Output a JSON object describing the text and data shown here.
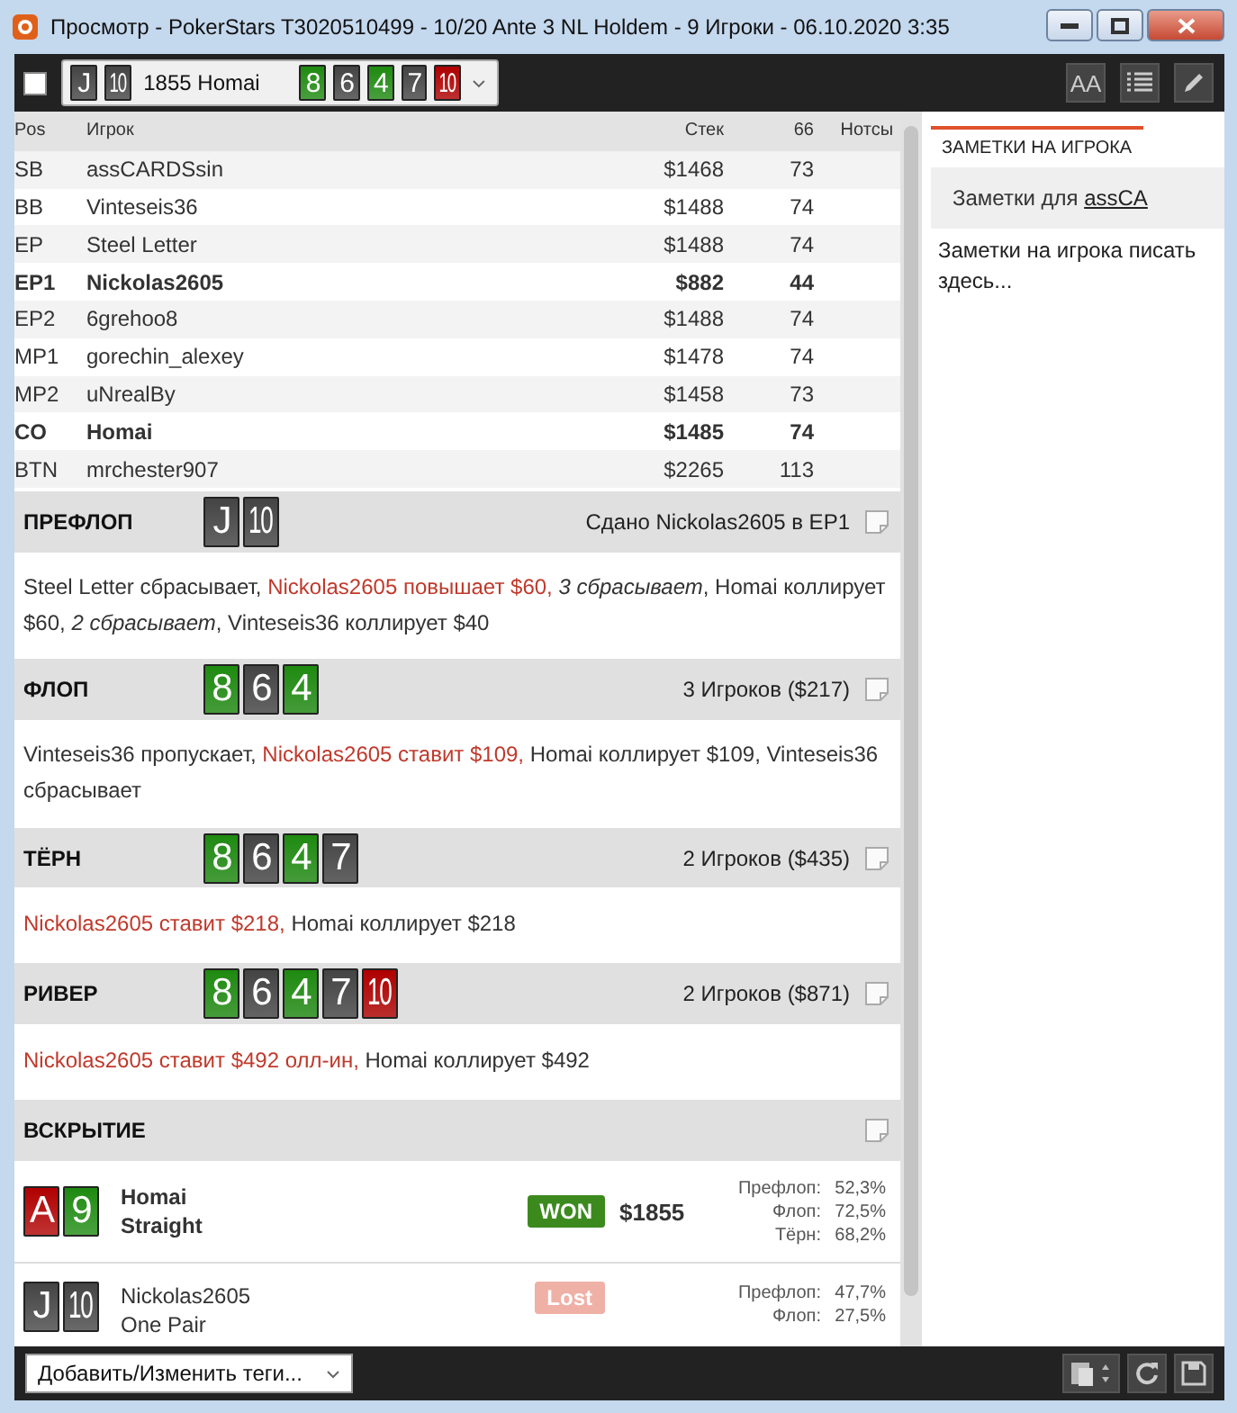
{
  "window": {
    "title": "Просмотр - PokerStars T3020510499 - 10/20 Ante 3 NL Holdem - 9 Игроки - 06.10.2020 3:35"
  },
  "toolbar": {
    "checked": false,
    "hand": {
      "hole_cards": [
        {
          "rank": "J",
          "color": "#444444"
        },
        {
          "rank": "10",
          "color": "#444444"
        }
      ],
      "label": "1855 Homai",
      "board": [
        {
          "rank": "8",
          "color": "#1e8a10"
        },
        {
          "rank": "6",
          "color": "#444444"
        },
        {
          "rank": "4",
          "color": "#1e8a10"
        },
        {
          "rank": "7",
          "color": "#444444"
        },
        {
          "rank": "10",
          "color": "#b00000"
        }
      ]
    },
    "font_button": "AA"
  },
  "table": {
    "columns": [
      "Pos",
      "Игрок",
      "Стек",
      "66",
      "Нотсы"
    ],
    "rows": [
      {
        "pos": "SB",
        "player": "assCARDSsin",
        "stack": "$1468",
        "hands": "73",
        "highlighted": false
      },
      {
        "pos": "BB",
        "player": "Vinteseis36",
        "stack": "$1488",
        "hands": "74",
        "highlighted": false
      },
      {
        "pos": "EP",
        "player": "Steel Letter",
        "stack": "$1488",
        "hands": "74",
        "highlighted": false
      },
      {
        "pos": "EP1",
        "player": "Nickolas2605",
        "stack": "$882",
        "hands": "44",
        "highlighted": true
      },
      {
        "pos": "EP2",
        "player": "6grehoo8",
        "stack": "$1488",
        "hands": "74",
        "highlighted": false
      },
      {
        "pos": "MP1",
        "player": "gorechin_alexey",
        "stack": "$1478",
        "hands": "74",
        "highlighted": false
      },
      {
        "pos": "MP2",
        "player": "uNrealBy",
        "stack": "$1458",
        "hands": "73",
        "highlighted": false
      },
      {
        "pos": "CO",
        "player": "Homai",
        "stack": "$1485",
        "hands": "74",
        "highlighted": true
      },
      {
        "pos": "BTN",
        "player": "mrchester907",
        "stack": "$2265",
        "hands": "113",
        "highlighted": false
      }
    ]
  },
  "streets": [
    {
      "name": "ПРЕФЛОП",
      "cards": [
        {
          "rank": "J",
          "color": "#444444"
        },
        {
          "rank": "10",
          "color": "#444444"
        }
      ],
      "summary": "Сдано Nickolas2605 в EP1",
      "actions": [
        {
          "kind": "plain",
          "text": "Steel Letter сбрасывает, "
        },
        {
          "kind": "hero",
          "text": "Nickolas2605 повышает $60, "
        },
        {
          "kind": "folds",
          "text": "3 сбрасывает"
        },
        {
          "kind": "plain",
          "text": ", Homai коллирует $60, "
        },
        {
          "kind": "folds",
          "text": "2 сбрасывает"
        },
        {
          "kind": "plain",
          "text": ", Vinteseis36 коллирует $40"
        }
      ]
    },
    {
      "name": "ФЛОП",
      "cards": [
        {
          "rank": "8",
          "color": "#1e8a10"
        },
        {
          "rank": "6",
          "color": "#444444"
        },
        {
          "rank": "4",
          "color": "#1e8a10"
        }
      ],
      "summary": "3 Игроков ($217)",
      "actions": [
        {
          "kind": "plain",
          "text": "Vinteseis36 пропускает, "
        },
        {
          "kind": "hero",
          "text": "Nickolas2605 ставит $109, "
        },
        {
          "kind": "plain",
          "text": "Homai коллирует $109, Vinteseis36 сбрасывает"
        }
      ]
    },
    {
      "name": "ТЁРН",
      "cards": [
        {
          "rank": "8",
          "color": "#1e8a10"
        },
        {
          "rank": "6",
          "color": "#444444"
        },
        {
          "rank": "4",
          "color": "#1e8a10"
        },
        {
          "rank": "7",
          "color": "#444444"
        }
      ],
      "summary": "2 Игроков ($435)",
      "actions": [
        {
          "kind": "hero",
          "text": "Nickolas2605 ставит $218, "
        },
        {
          "kind": "plain",
          "text": "Homai коллирует $218"
        }
      ]
    },
    {
      "name": "РИВЕР",
      "cards": [
        {
          "rank": "8",
          "color": "#1e8a10"
        },
        {
          "rank": "6",
          "color": "#444444"
        },
        {
          "rank": "4",
          "color": "#1e8a10"
        },
        {
          "rank": "7",
          "color": "#444444"
        },
        {
          "rank": "10",
          "color": "#b00000"
        }
      ],
      "summary": "2 Игроков ($871)",
      "actions": [
        {
          "kind": "hero",
          "text": "Nickolas2605 ставит $492 олл-ин, "
        },
        {
          "kind": "plain",
          "text": "Homai коллирует $492"
        }
      ]
    }
  ],
  "showdown": {
    "title": "ВСКРЫТИЕ",
    "players": [
      {
        "cards": [
          {
            "rank": "A",
            "color": "#b00000"
          },
          {
            "rank": "9",
            "color": "#1e8a10"
          }
        ],
        "name": "Homai",
        "hand": "Straight",
        "kind": "won",
        "result": "WON",
        "amount": "$1855",
        "equity": [
          {
            "street": "Префлоп:",
            "value": "52,3%"
          },
          {
            "street": "Флоп:",
            "value": "72,5%"
          },
          {
            "street": "Тёрн:",
            "value": "68,2%"
          }
        ]
      },
      {
        "cards": [
          {
            "rank": "J",
            "color": "#444444"
          },
          {
            "rank": "10",
            "color": "#444444"
          }
        ],
        "name": "Nickolas2605",
        "hand": "One Pair",
        "kind": "lost",
        "result": "Lost",
        "equity": [
          {
            "street": "Префлоп:",
            "value": "47,7%"
          },
          {
            "street": "Флоп:",
            "value": "27,5%"
          }
        ]
      }
    ]
  },
  "notes": {
    "tab": "ЗАМЕТКИ НА ИГРОКА",
    "header": "Заметки для ",
    "player": "assCA",
    "placeholder": "Заметки на игрока писать здесь..."
  },
  "bottom_bar": {
    "tags_select": "Добавить/Изменить теги..."
  }
}
